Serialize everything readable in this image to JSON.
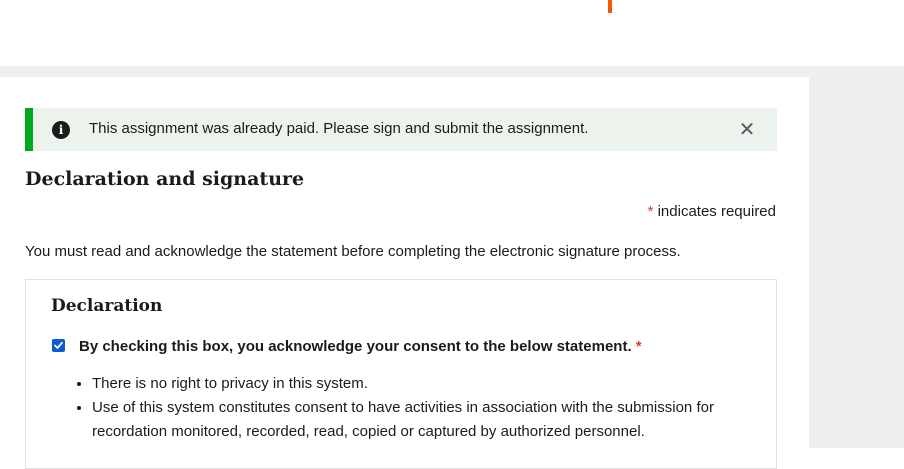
{
  "colors": {
    "brand_accent": "#f05a00",
    "success_border": "#00a91c",
    "alert_background": "#ecf3ec",
    "required_asterisk": "#d83933",
    "checkbox_checked": "#0b5cd5"
  },
  "alert": {
    "icon": "info-icon",
    "message": "This assignment was already paid. Please sign and submit the assignment.",
    "close_icon": "close-icon",
    "close_glyph": "✕"
  },
  "form": {
    "section_title": "Declaration and signature",
    "required_asterisk": "*",
    "required_note": " indicates required",
    "instruction": "You must read and acknowledge the statement before completing the electronic signature process."
  },
  "declaration": {
    "title": "Declaration",
    "checkbox_checked": true,
    "consent_label": "By checking this box, you acknowledge your consent to the below statement.",
    "consent_required": "*",
    "statements": [
      "There is no right to privacy in this system.",
      "Use of this system constitutes consent to have activities in association with the submission for recordation monitored, recorded, read, copied or captured by authorized personnel."
    ]
  }
}
